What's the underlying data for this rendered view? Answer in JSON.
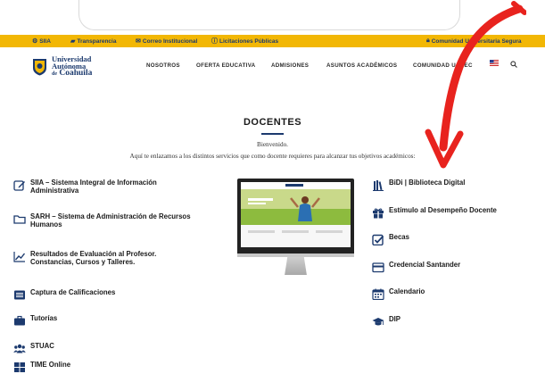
{
  "utility_bar": {
    "siia": "SIIA",
    "transparencia": "Transparencia",
    "correo": "Correo Institucional",
    "licitaciones": "Licitaciones Públicas",
    "comunidad": "Comunidad Universitaria Segura"
  },
  "logo": {
    "line1": "Universidad",
    "line2": "Autónoma",
    "line3_prefix": "de",
    "line3": "Coahuila"
  },
  "nav": {
    "items": [
      "NOSOTROS",
      "OFERTA EDUCATIVA",
      "ADMISIONES",
      "ASUNTOS ACADÉMICOS",
      "COMUNIDAD UADEC"
    ]
  },
  "page": {
    "title": "DOCENTES",
    "welcome": "Bienvenido.",
    "intro": "Aquí te enlazamos a los distintos servicios que como docente requieres para alcanzar tus objetivos académicos:"
  },
  "left_services": [
    {
      "label": "SIIA – Sistema Integral de Información\nAdministrativa",
      "icon": "edit-icon"
    },
    {
      "label": "SARH – Sistema de Administración de Recursos\nHumanos",
      "icon": "folder-icon"
    },
    {
      "label": "Resultados de Evaluación al Profesor.\nConstancias, Cursos y Talleres.",
      "icon": "chart-line-icon"
    },
    {
      "label": "Captura de Calificaciones",
      "icon": "list-icon"
    },
    {
      "label": "Tutorías",
      "icon": "briefcase-icon"
    },
    {
      "label": "STUAC",
      "icon": "users-icon"
    },
    {
      "label": "TIME Online",
      "icon": "grid-icon"
    }
  ],
  "right_services": [
    {
      "label": "BiDi | Biblioteca Digital",
      "icon": "book-icon"
    },
    {
      "label": "Estímulo al Desempeño Docente",
      "icon": "gift-icon"
    },
    {
      "label": "Becas",
      "icon": "check-square-icon"
    },
    {
      "label": "Credencial Santander",
      "icon": "card-icon"
    },
    {
      "label": "Calendario",
      "icon": "calendar-icon"
    },
    {
      "label": "DIP",
      "icon": "graduation-cap-icon"
    }
  ],
  "colors": {
    "brand_blue": "#1c3a6e",
    "utility_yellow": "#f2b705",
    "annotation_red": "#e8231e"
  }
}
